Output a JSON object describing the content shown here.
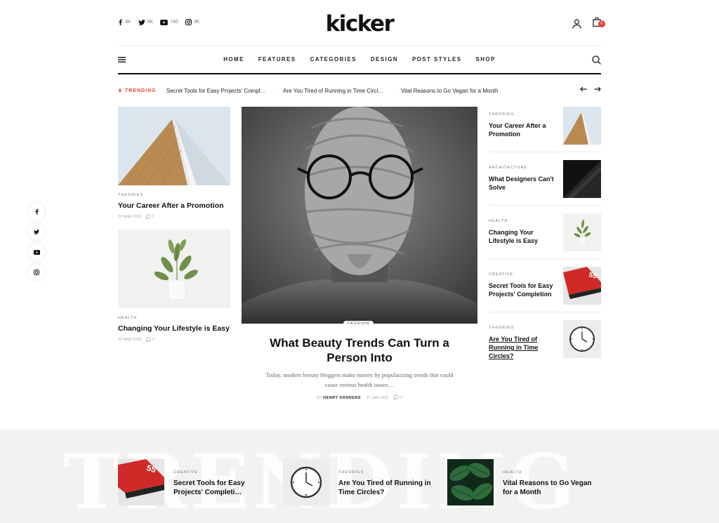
{
  "brand": {
    "logo": "kicker",
    "accent": "#e8412f"
  },
  "header": {
    "socials": [
      {
        "icon": "facebook-icon",
        "count": "3K"
      },
      {
        "icon": "twitter-icon",
        "count": "3K"
      },
      {
        "icon": "youtube-icon",
        "count": "740"
      },
      {
        "icon": "instagram-icon",
        "count": "3K"
      }
    ],
    "cart_count": "0"
  },
  "nav": {
    "items": [
      "HOME",
      "FEATURES",
      "CATEGORIES",
      "DESIGN",
      "POST STYLES",
      "SHOP"
    ]
  },
  "ticker": {
    "label": "TRENDING",
    "items": [
      "Secret Tools for Easy Projects' Compl…",
      "Are You Tired of Running in Time Circl…",
      "Vital Reasons to Go Vegan for a Month"
    ]
  },
  "left": [
    {
      "category": "THEORIES",
      "title": "Your Career After a Promotion",
      "date": "30 MAR 2020",
      "comments": "2"
    },
    {
      "category": "HEALTH",
      "title": "Changing Your Lifestyle is Easy",
      "date": "30 MAR 2020",
      "comments": "2"
    }
  ],
  "feature": {
    "category": "FASHION",
    "title": "What Beauty Trends Can Turn a Person Into",
    "excerpt": "Today, modern beauty bloggers make money by popularizing trends that could cause serious health issues…",
    "by": "BY",
    "author": "HENRY SANDERS",
    "date": "27 JAN 2020",
    "comments": "0"
  },
  "right": [
    {
      "category": "THEORIES",
      "title": "Your Career After a Promotion"
    },
    {
      "category": "ARCHITECTURE",
      "title": "What Designers Can't Solve"
    },
    {
      "category": "HEALTH",
      "title": "Changing Your Lifestyle is Easy"
    },
    {
      "category": "CREATIVE",
      "title": "Secret Tools for Easy Projects' Completion"
    },
    {
      "category": "THEORIES",
      "title": "Are You Tired of Running in Time Circles?"
    }
  ],
  "floating_social": [
    "facebook-icon",
    "twitter-icon",
    "youtube-icon",
    "instagram-icon"
  ],
  "bottom": {
    "watermark": "TRENDING",
    "cards": [
      {
        "category": "CREATIVE",
        "title": "Secret Tools for Easy Projects' Completi…"
      },
      {
        "category": "THEORIES",
        "title": "Are You Tired of Running in Time Circles?"
      },
      {
        "category": "HEALTH",
        "title": "Vital Reasons to Go Vegan for a Month"
      }
    ]
  }
}
